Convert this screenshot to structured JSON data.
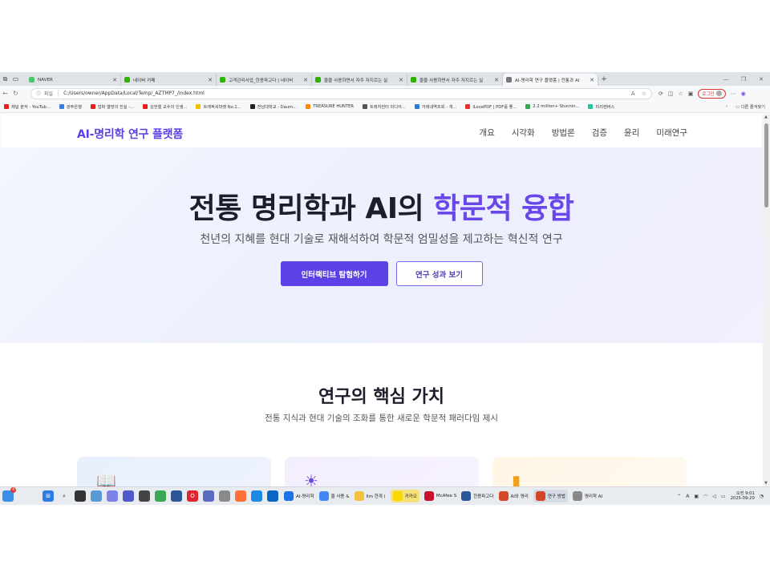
{
  "tabs": [
    {
      "title": "NAVER",
      "color": "#4fc36e",
      "active": false
    },
    {
      "title": "네이버 카페",
      "color": "#2db400",
      "active": false
    },
    {
      "title": "고객관리사업_한용파고다 | 네이버",
      "color": "#2db400",
      "active": false
    },
    {
      "title": "줄줄 사용하면서 자주 저지르는 실",
      "color": "#2db400",
      "active": false
    },
    {
      "title": "줄줄 사용하면서 자주 저지르는 실",
      "color": "#2db400",
      "active": false
    },
    {
      "title": "AI-명리학 연구 플랫폼 | 전통과 AI",
      "color": "#777777",
      "active": true
    }
  ],
  "address": {
    "protocol_label": "파일",
    "url": "C:/Users/owner/AppData/Local/Temp/_AZTMP7_/index.html"
  },
  "toolbar": {
    "profile_label": "로그인"
  },
  "bookmarks": [
    {
      "label": "채널 분석 - YouTub...",
      "color": "#e62117"
    },
    {
      "label": "광주은행",
      "color": "#3a7be0"
    },
    {
      "label": "밥퍼 열망의 진실 -...",
      "color": "#e62117"
    },
    {
      "label": "김헌철 교수의 인생...",
      "color": "#e62117"
    },
    {
      "label": "트래픽셔마켓 No.1...",
      "color": "#f2c200"
    },
    {
      "label": "전남대학교 - Daum...",
      "color": "#222222"
    },
    {
      "label": "TREASURE HUNTER",
      "color": "#ff8a00"
    },
    {
      "label": "트래저헌터 미디어...",
      "color": "#555555"
    },
    {
      "label": "거래내역조회 - 개...",
      "color": "#2a7bd6"
    },
    {
      "label": "iLovePDF | PDF를 좋...",
      "color": "#e5322d"
    },
    {
      "label": "2.2 million+ Stunnin...",
      "color": "#35a853"
    },
    {
      "label": "미리캔버스",
      "color": "#27c3a0"
    }
  ],
  "bookmarks_more_label": "다른 즐겨찾기",
  "site": {
    "logo": "AI-명리학 연구 플랫폼",
    "nav": [
      "개요",
      "시각화",
      "방법론",
      "검증",
      "윤리",
      "미래연구"
    ],
    "hero": {
      "title_main": "전통 명리학과 AI의 ",
      "title_highlight": "학문적 융합",
      "subtitle": "천년의 지혜를 현대 기술로 재해석하여 학문적 엄밀성을 제고하는 혁신적 연구",
      "btn_primary": "인터랙티브 탐험하기",
      "btn_secondary": "연구 성과 보기"
    },
    "values": {
      "title": "연구의 핵심 가치",
      "subtitle": "전통 지식과 현대 기술의 조화를 통한 새로운 학문적 패러다임 제시"
    },
    "cards": [
      {
        "icon": "book-icon"
      },
      {
        "icon": "lightbulb-icon"
      },
      {
        "icon": "chart-icon"
      }
    ]
  },
  "taskbar": {
    "apps": [
      {
        "label": "AI-명리학",
        "color": "#1a73e8"
      },
      {
        "label": "줄 사용 &",
        "color": "#4285f4"
      },
      {
        "label": "llm 한계 (",
        "color": "#f5c242"
      },
      {
        "label": "카카오",
        "color": "#f7d800"
      },
      {
        "label": "McAfee S",
        "color": "#c8102e"
      },
      {
        "label": "한용파고다",
        "color": "#2b579a"
      },
      {
        "label": "AI와 명리",
        "color": "#d24726"
      },
      {
        "label": "연구 방법",
        "color": "#d24726"
      },
      {
        "label": "명리학 AI",
        "color": "#888888"
      }
    ],
    "tray_lang": "A",
    "tray_ime": "(A)",
    "clock_time": "오전 9:01",
    "clock_date": "2025-09-20",
    "notif_badge": "4"
  }
}
